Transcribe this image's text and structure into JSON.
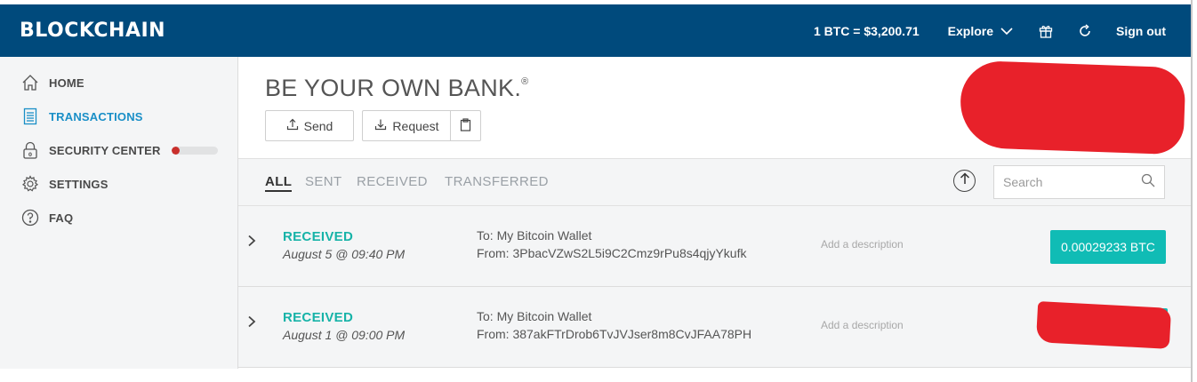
{
  "header": {
    "logo": "BLOCKCHAIN",
    "price": "1 BTC = $3,200.71",
    "explore_label": "Explore",
    "signout_label": "Sign out",
    "bg_color": "#004a7c"
  },
  "sidebar": {
    "items": [
      {
        "label": "HOME",
        "icon": "home-icon",
        "active": false
      },
      {
        "label": "TRANSACTIONS",
        "icon": "transactions-icon",
        "active": true
      },
      {
        "label": "SECURITY CENTER",
        "icon": "lock-icon",
        "active": false,
        "progress": 0.18
      },
      {
        "label": "SETTINGS",
        "icon": "gear-icon",
        "active": false
      },
      {
        "label": "FAQ",
        "icon": "question-icon",
        "active": false
      }
    ]
  },
  "main": {
    "title": "BE YOUR OWN BANK.",
    "title_mark": "®",
    "send_label": "Send",
    "request_label": "Request",
    "tabs": [
      "ALL",
      "SENT",
      "RECEIVED",
      "TRANSFERRED"
    ],
    "active_tab": "ALL",
    "search_placeholder": "Search"
  },
  "transactions": [
    {
      "type": "RECEIVED",
      "date": "August 5 @ 09:40 PM",
      "to": "To: My Bitcoin Wallet",
      "from": "From: 3PbacVZwS2L5i9C2Cmz9rPu8s4qjyYkufk",
      "description_placeholder": "Add a description",
      "amount": "0.00029233 BTC"
    },
    {
      "type": "RECEIVED",
      "date": "August 1 @ 09:00 PM",
      "to": "To: My Bitcoin Wallet",
      "from": "From: 387akFTrDrob6TvJVJser8m8CvJFAA78PH",
      "description_placeholder": "Add a description",
      "amount": "",
      "amount_redacted": true
    }
  ],
  "colors": {
    "accent_teal": "#10bcb5",
    "received_text": "#17b3a8",
    "active_nav": "#1a8fc7",
    "redaction": "#e8212a"
  }
}
